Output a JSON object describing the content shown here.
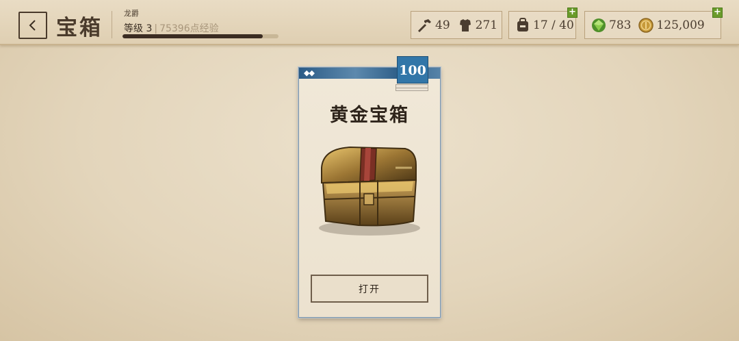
{
  "header": {
    "title": "宝箱",
    "player_name": "龙爵",
    "level_label": "等级 3",
    "level_sep": "|",
    "xp_label": "75396点经验",
    "xp_progress": 0.9
  },
  "resources": {
    "crafting": "49",
    "armor": "271",
    "inventory": "17 / 40",
    "gems": "783",
    "gold": "125,009",
    "plus": "+"
  },
  "card": {
    "gems_mark": "◆◆",
    "count": "100",
    "title": "黄金宝箱",
    "open_label": "打开"
  },
  "colors": {
    "band": "#3e6d95",
    "badge": "#3276a8",
    "plus": "#6a9b2a"
  }
}
